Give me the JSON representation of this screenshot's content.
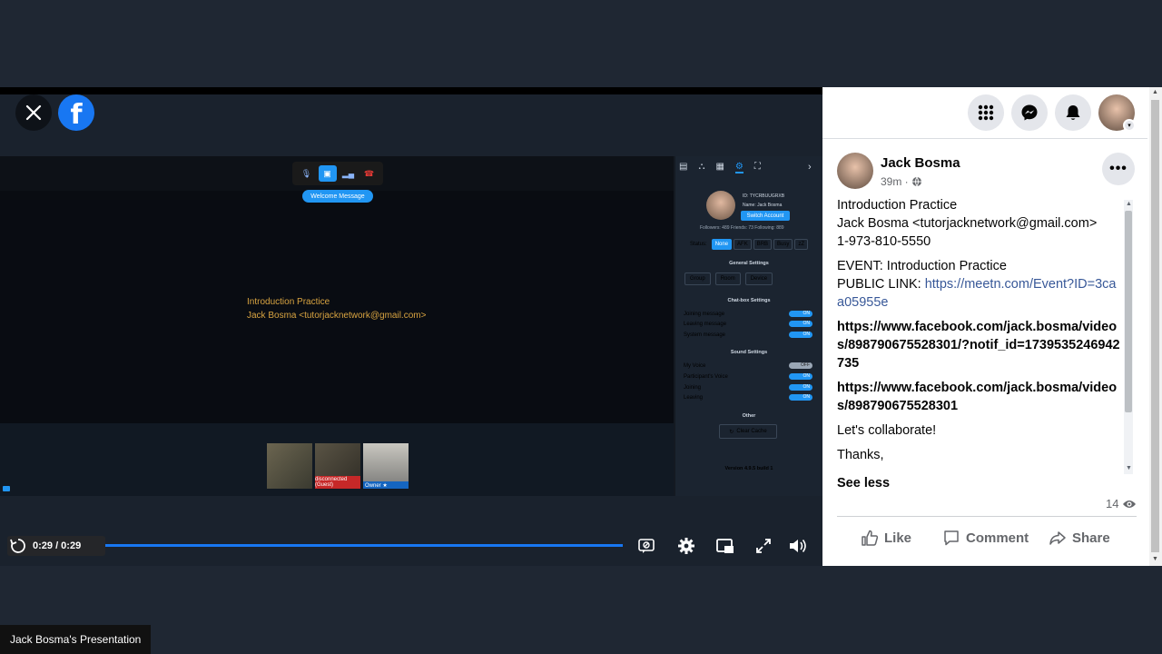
{
  "viewer": {
    "close_icon": "close-icon",
    "brand_icon": "facebook-logo",
    "brand_letter": "f"
  },
  "meeting": {
    "welcome_label": "Welcome Message",
    "intro_line1": "Introduction Practice",
    "intro_line2": "Jack Bosma <tutorjacknetwork@gmail.com>",
    "thumb2_label": "disconnected (Guest)",
    "thumb3_label": "Owner ★",
    "panel": {
      "id_line": "ID: TYCRBUUGRXB",
      "name_line": "Name: Jack Bosma",
      "switch_account": "Switch Account",
      "followers_line": "Followers: 489   Friends: 73   Following: 889",
      "status_label": "Status:",
      "statuses": [
        "None",
        "AFK",
        "BRB",
        "Busy",
        "zZ"
      ],
      "general_title": "General Settings",
      "general_buttons": [
        "Group",
        "Room",
        "Device"
      ],
      "chatbox_title": "Chat-box Settings",
      "chatbox_items": [
        {
          "label": "Joining message",
          "state": "ON"
        },
        {
          "label": "Leaving message",
          "state": "ON"
        },
        {
          "label": "System message",
          "state": "ON"
        }
      ],
      "sound_title": "Sound Settings",
      "sound_items": [
        {
          "label": "My Voice",
          "state": "OFF"
        },
        {
          "label": "Participant's Voice",
          "state": "ON"
        },
        {
          "label": "Joining",
          "state": "ON"
        },
        {
          "label": "Leaving",
          "state": "ON"
        }
      ],
      "other_title": "Other",
      "clear_cache": "Clear Cache",
      "version": "Version 4.9.5 build 1"
    }
  },
  "player": {
    "time": "0:29 / 0:29",
    "progress_fraction": 1.0,
    "hidden_title": "Jack Bosma's Presentation"
  },
  "header": {
    "menu_icon": "grid-menu-icon",
    "messenger_icon": "messenger-icon",
    "notifications_icon": "bell-icon"
  },
  "post": {
    "author": "Jack Bosma",
    "time": "39m ·",
    "line1": "Introduction Practice",
    "line2": "Jack Bosma <tutorjacknetwork@gmail.com>",
    "line3": "1-973-810-5550",
    "event_line": "EVENT: Introduction Practice",
    "public_link_label": "PUBLIC LINK: ",
    "public_link_url": "https://meetn.com/Event?ID=3caa05955e",
    "link1": "https://www.facebook.com/jack.bosma/videos/898790675528301/?notif_id=1739535246942735",
    "link2": "https://www.facebook.com/jack.bosma/videos/898790675528301",
    "collab": "Let's collaborate!",
    "thanks": "Thanks,",
    "see_less": "See less",
    "views": "14",
    "actions": {
      "like": "Like",
      "comment": "Comment",
      "share": "Share"
    }
  },
  "caption": "Jack Bosma's Presentation",
  "colors": {
    "accent": "#1877f2",
    "meet_blue": "#2196f3",
    "intro_text": "#d9a441"
  }
}
